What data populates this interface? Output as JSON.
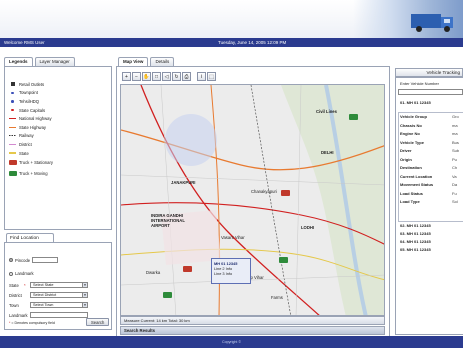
{
  "header": {
    "user_label": "Welcome RMS User",
    "datetime": "Tuesday, June 14, 2005 12:09 PM"
  },
  "left_panel": {
    "tabs": [
      "Legends",
      "Layer Manager"
    ],
    "legend_items": [
      {
        "label": "Retail Outlets",
        "icon": "retail-outlet-icon",
        "color": "#333333"
      },
      {
        "label": "Townpoint",
        "icon": "townpoint-icon",
        "color": "#3b4fb8"
      },
      {
        "label": "TehsilHDQ",
        "icon": "tehsil-icon",
        "color": "#3b4fb8"
      },
      {
        "label": "State Capitals",
        "icon": "state-capital-icon",
        "color": "#d12020"
      },
      {
        "label": "National Highway",
        "icon": "highway-line-icon",
        "color": "#d12020"
      },
      {
        "label": "State Highway",
        "icon": "highway-line-icon",
        "color": "#e87a30"
      },
      {
        "label": "Railway",
        "icon": "railway-icon",
        "color": "#333333"
      },
      {
        "label": "District",
        "icon": "district-line-icon",
        "color": "#d38ad0"
      },
      {
        "label": "State",
        "icon": "state-line-icon",
        "color": "#e5c84a"
      },
      {
        "label": "Truck + Stationary",
        "icon": "truck-stationary-icon",
        "color": "#c0392b"
      },
      {
        "label": "Truck + Moving",
        "icon": "truck-moving-icon",
        "color": "#2e8b3a"
      }
    ],
    "find_location": {
      "title": "Find Location",
      "pincode_label": "Pincode",
      "landmark_label": "Landmark",
      "state_label": "State",
      "state_value": "Select State",
      "district_label": "District",
      "district_value": "Select District",
      "town_label": "Town",
      "town_value": "Select Town",
      "landmark_field_label": "Landmark",
      "required_note": "= Denotes compulsory field",
      "search_button": "Search"
    }
  },
  "center_panel": {
    "tabs": [
      "Map View",
      "Details"
    ],
    "toolbar_icons": [
      "zoom-in-icon",
      "zoom-out-icon",
      "pan-icon",
      "zoom-extent-icon",
      "zoom-previous-icon",
      "refresh-icon",
      "print-icon",
      "info-icon",
      "select-icon"
    ],
    "map_labels": [
      "Civil Lines",
      "Chanakyapuri",
      "INDIRA GANDHI INTERNATIONAL AIRPORT",
      "JANAKPURI",
      "Farms",
      "DELHI",
      "LODHI",
      "Dwarka",
      "Pushp Vihar",
      "Vasant Vihar"
    ],
    "popup": {
      "title": "MH 01 12345",
      "line1": "Line 2 Info",
      "line2": "Line 3 Info"
    },
    "measure_text": "Measure Current: 14 km Total: 30 km",
    "results_title": "Search Results"
  },
  "right_panel": {
    "header": "Vehicle Tracking",
    "enter_vehicle_label": "Enter Vehicle Number",
    "selected_vehicle": "01. MH 01 12345",
    "fields": [
      "Vehicle Group",
      "Chassis No",
      "Engine No",
      "Vehicle Type",
      "Driver",
      "Origin",
      "Destination",
      "Current Location",
      "Movement Status",
      "Load Status",
      "Load Type"
    ],
    "field_value_fragments": [
      "Gro",
      "ma",
      "ma",
      "Bus",
      "Sub",
      "Pu",
      "Ch",
      "Va",
      "Da",
      "Fu",
      "Sol"
    ],
    "vehicles": [
      "02. MH 01 12345",
      "03. MH 01 12345",
      "04. MH 01 12345",
      "05. MH 01 12345"
    ]
  },
  "footer": {
    "text": "Copyright ©"
  },
  "colors": {
    "nav_bar": "#2b3b8f",
    "panel_border": "#9aa3b5"
  }
}
